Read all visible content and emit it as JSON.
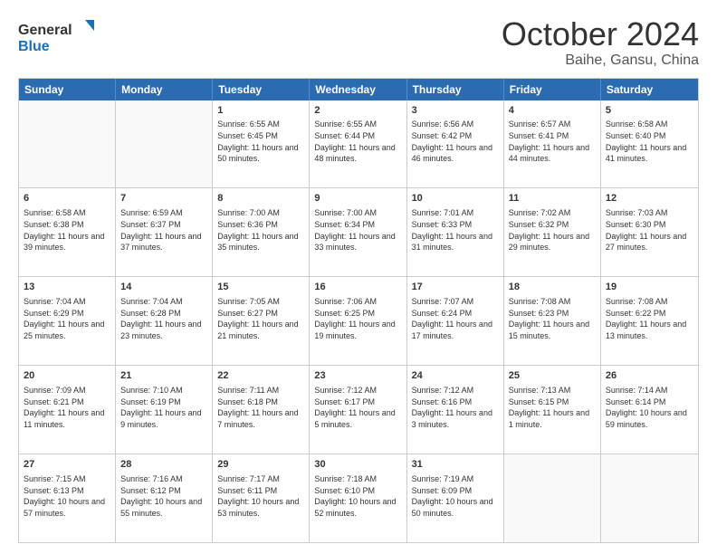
{
  "logo": {
    "line1": "General",
    "line2": "Blue"
  },
  "title": "October 2024",
  "location": "Baihe, Gansu, China",
  "days": [
    "Sunday",
    "Monday",
    "Tuesday",
    "Wednesday",
    "Thursday",
    "Friday",
    "Saturday"
  ],
  "weeks": [
    [
      {
        "day": "",
        "info": "",
        "empty": true
      },
      {
        "day": "",
        "info": "",
        "empty": true
      },
      {
        "day": "1",
        "info": "Sunrise: 6:55 AM\nSunset: 6:45 PM\nDaylight: 11 hours and 50 minutes."
      },
      {
        "day": "2",
        "info": "Sunrise: 6:55 AM\nSunset: 6:44 PM\nDaylight: 11 hours and 48 minutes."
      },
      {
        "day": "3",
        "info": "Sunrise: 6:56 AM\nSunset: 6:42 PM\nDaylight: 11 hours and 46 minutes."
      },
      {
        "day": "4",
        "info": "Sunrise: 6:57 AM\nSunset: 6:41 PM\nDaylight: 11 hours and 44 minutes."
      },
      {
        "day": "5",
        "info": "Sunrise: 6:58 AM\nSunset: 6:40 PM\nDaylight: 11 hours and 41 minutes."
      }
    ],
    [
      {
        "day": "6",
        "info": "Sunrise: 6:58 AM\nSunset: 6:38 PM\nDaylight: 11 hours and 39 minutes."
      },
      {
        "day": "7",
        "info": "Sunrise: 6:59 AM\nSunset: 6:37 PM\nDaylight: 11 hours and 37 minutes."
      },
      {
        "day": "8",
        "info": "Sunrise: 7:00 AM\nSunset: 6:36 PM\nDaylight: 11 hours and 35 minutes."
      },
      {
        "day": "9",
        "info": "Sunrise: 7:00 AM\nSunset: 6:34 PM\nDaylight: 11 hours and 33 minutes."
      },
      {
        "day": "10",
        "info": "Sunrise: 7:01 AM\nSunset: 6:33 PM\nDaylight: 11 hours and 31 minutes."
      },
      {
        "day": "11",
        "info": "Sunrise: 7:02 AM\nSunset: 6:32 PM\nDaylight: 11 hours and 29 minutes."
      },
      {
        "day": "12",
        "info": "Sunrise: 7:03 AM\nSunset: 6:30 PM\nDaylight: 11 hours and 27 minutes."
      }
    ],
    [
      {
        "day": "13",
        "info": "Sunrise: 7:04 AM\nSunset: 6:29 PM\nDaylight: 11 hours and 25 minutes."
      },
      {
        "day": "14",
        "info": "Sunrise: 7:04 AM\nSunset: 6:28 PM\nDaylight: 11 hours and 23 minutes."
      },
      {
        "day": "15",
        "info": "Sunrise: 7:05 AM\nSunset: 6:27 PM\nDaylight: 11 hours and 21 minutes."
      },
      {
        "day": "16",
        "info": "Sunrise: 7:06 AM\nSunset: 6:25 PM\nDaylight: 11 hours and 19 minutes."
      },
      {
        "day": "17",
        "info": "Sunrise: 7:07 AM\nSunset: 6:24 PM\nDaylight: 11 hours and 17 minutes."
      },
      {
        "day": "18",
        "info": "Sunrise: 7:08 AM\nSunset: 6:23 PM\nDaylight: 11 hours and 15 minutes."
      },
      {
        "day": "19",
        "info": "Sunrise: 7:08 AM\nSunset: 6:22 PM\nDaylight: 11 hours and 13 minutes."
      }
    ],
    [
      {
        "day": "20",
        "info": "Sunrise: 7:09 AM\nSunset: 6:21 PM\nDaylight: 11 hours and 11 minutes."
      },
      {
        "day": "21",
        "info": "Sunrise: 7:10 AM\nSunset: 6:19 PM\nDaylight: 11 hours and 9 minutes."
      },
      {
        "day": "22",
        "info": "Sunrise: 7:11 AM\nSunset: 6:18 PM\nDaylight: 11 hours and 7 minutes."
      },
      {
        "day": "23",
        "info": "Sunrise: 7:12 AM\nSunset: 6:17 PM\nDaylight: 11 hours and 5 minutes."
      },
      {
        "day": "24",
        "info": "Sunrise: 7:12 AM\nSunset: 6:16 PM\nDaylight: 11 hours and 3 minutes."
      },
      {
        "day": "25",
        "info": "Sunrise: 7:13 AM\nSunset: 6:15 PM\nDaylight: 11 hours and 1 minute."
      },
      {
        "day": "26",
        "info": "Sunrise: 7:14 AM\nSunset: 6:14 PM\nDaylight: 10 hours and 59 minutes."
      }
    ],
    [
      {
        "day": "27",
        "info": "Sunrise: 7:15 AM\nSunset: 6:13 PM\nDaylight: 10 hours and 57 minutes."
      },
      {
        "day": "28",
        "info": "Sunrise: 7:16 AM\nSunset: 6:12 PM\nDaylight: 10 hours and 55 minutes."
      },
      {
        "day": "29",
        "info": "Sunrise: 7:17 AM\nSunset: 6:11 PM\nDaylight: 10 hours and 53 minutes."
      },
      {
        "day": "30",
        "info": "Sunrise: 7:18 AM\nSunset: 6:10 PM\nDaylight: 10 hours and 52 minutes."
      },
      {
        "day": "31",
        "info": "Sunrise: 7:19 AM\nSunset: 6:09 PM\nDaylight: 10 hours and 50 minutes."
      },
      {
        "day": "",
        "info": "",
        "empty": true
      },
      {
        "day": "",
        "info": "",
        "empty": true
      }
    ]
  ]
}
